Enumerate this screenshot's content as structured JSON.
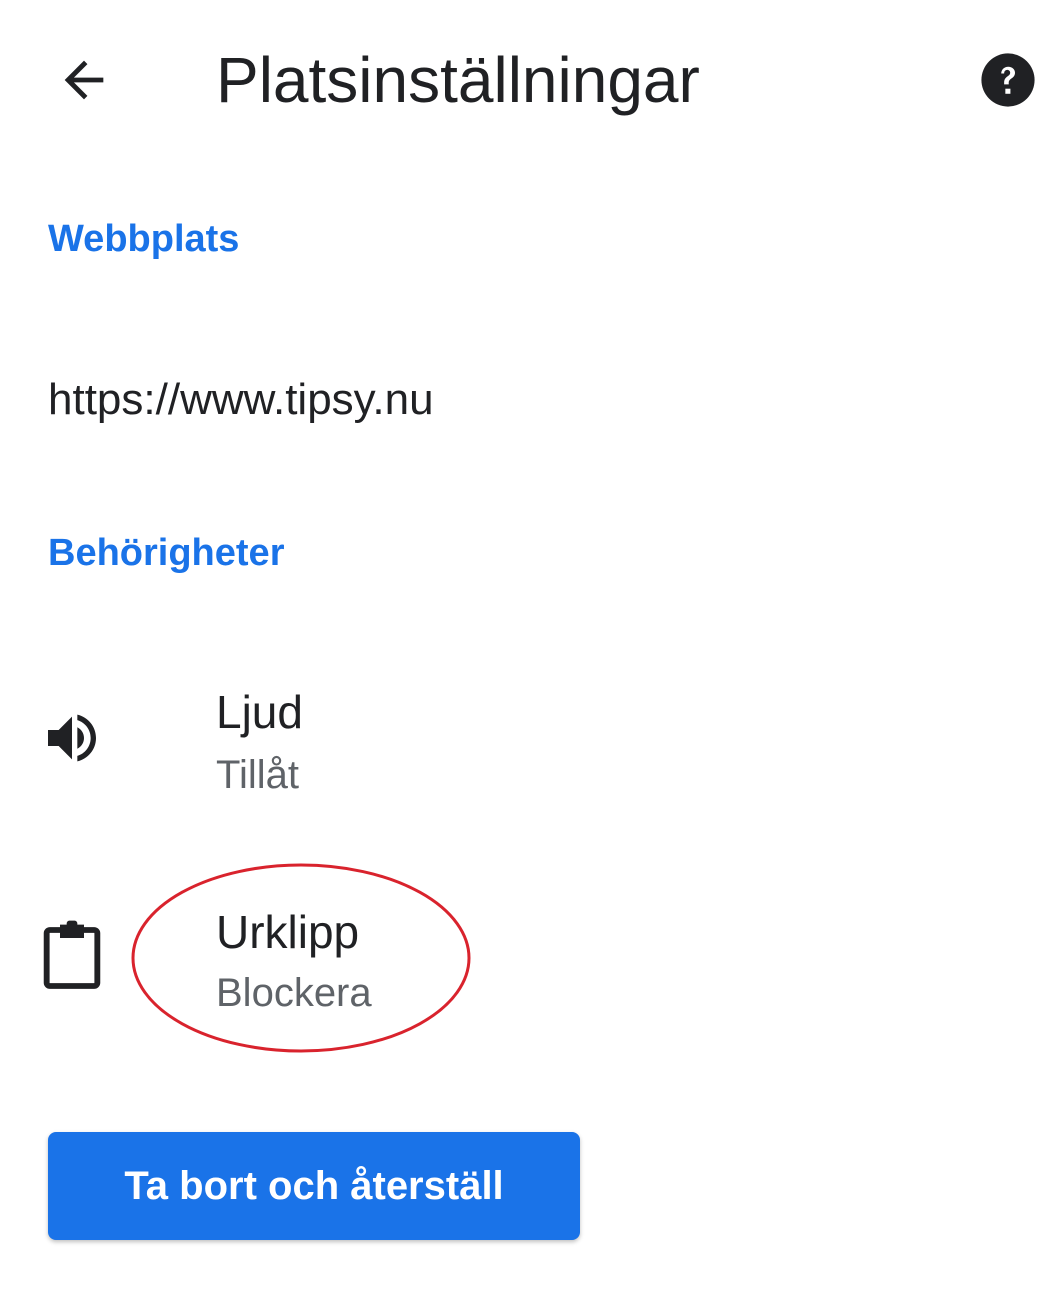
{
  "header": {
    "title": "Platsinställningar",
    "back_icon": "arrow-back-icon",
    "help_icon": "help-icon"
  },
  "sections": {
    "website_label": "Webbplats",
    "website_url": "https://www.tipsy.nu",
    "permissions_label": "Behörigheter"
  },
  "permissions": [
    {
      "icon": "volume-icon",
      "title": "Ljud",
      "status": "Tillåt"
    },
    {
      "icon": "clipboard-icon",
      "title": "Urklipp",
      "status": "Blockera"
    }
  ],
  "actions": {
    "reset_label": "Ta bort och återställ"
  },
  "colors": {
    "accent": "#1a73e8",
    "text_primary": "#202124",
    "text_secondary": "#5f6368",
    "annotation": "#d9232d"
  }
}
